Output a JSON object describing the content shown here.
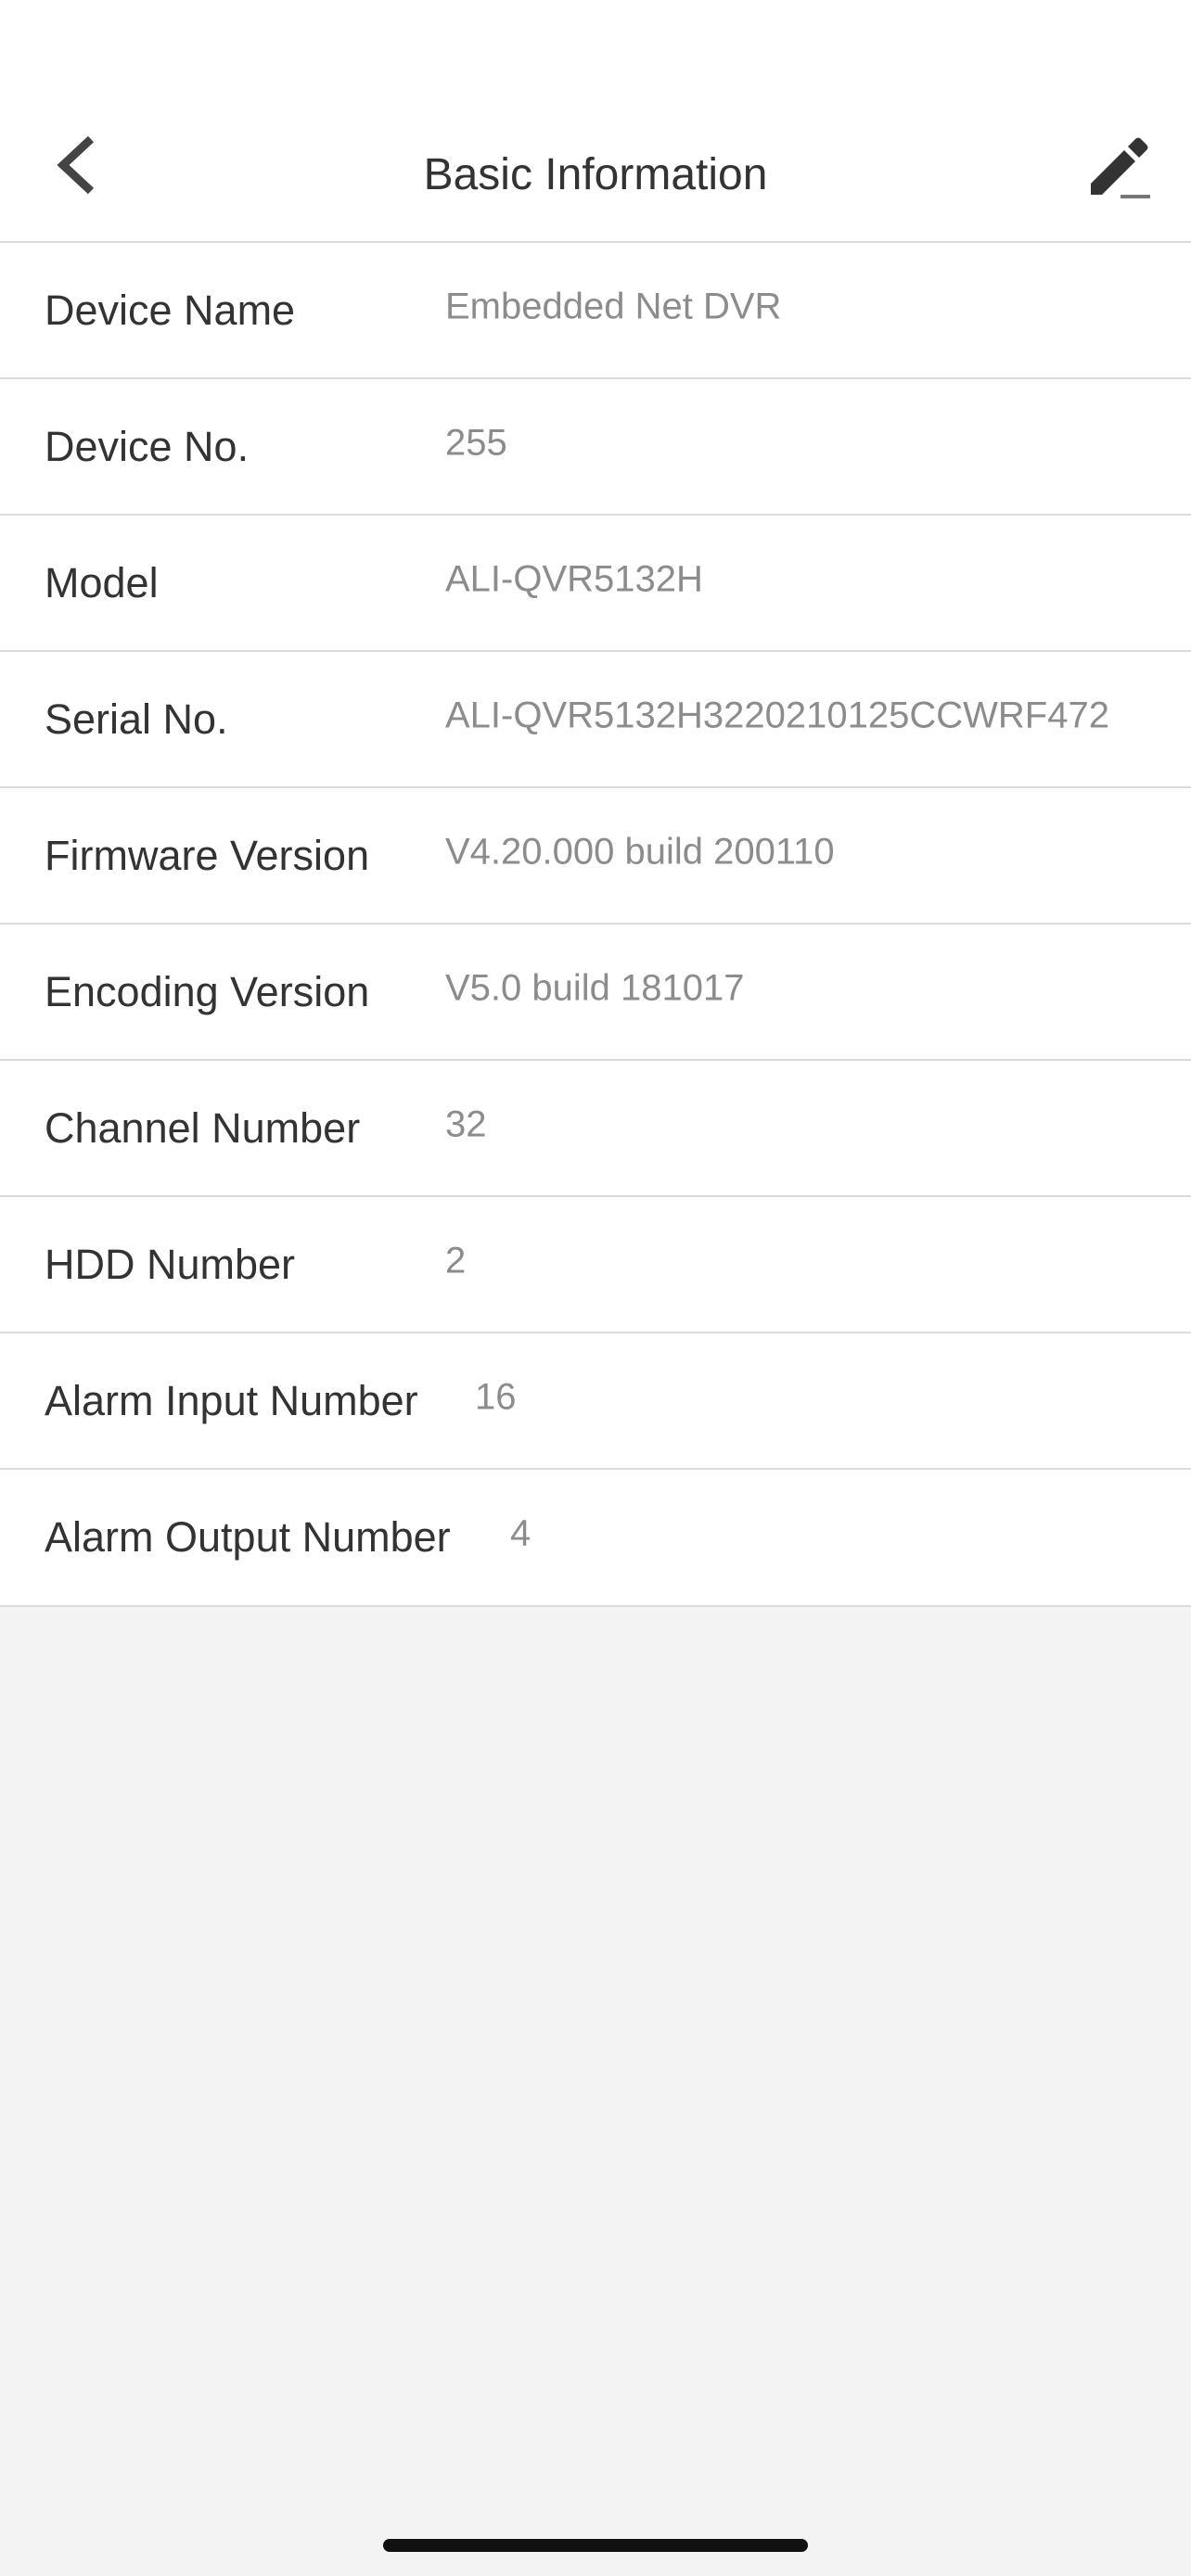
{
  "header": {
    "title": "Basic Information",
    "back_icon": "chevron-left-icon",
    "edit_icon": "pencil-icon"
  },
  "info": [
    {
      "label": "Device Name",
      "value": "Embedded Net DVR"
    },
    {
      "label": "Device No.",
      "value": "255"
    },
    {
      "label": "Model",
      "value": "ALI-QVR5132H"
    },
    {
      "label": "Serial No.",
      "value": "ALI-QVR5132H3220210125CCWRF472"
    },
    {
      "label": "Firmware Version",
      "value": "V4.20.000 build 200110"
    },
    {
      "label": "Encoding Version",
      "value": "V5.0 build 181017"
    },
    {
      "label": "Channel Number",
      "value": "32"
    },
    {
      "label": "HDD Number",
      "value": "2"
    },
    {
      "label": "Alarm Input Number",
      "value": "16"
    },
    {
      "label": "Alarm Output Number",
      "value": "4"
    }
  ],
  "colors": {
    "background": "#f3f3f3",
    "surface": "#ffffff",
    "label_text": "#333333",
    "value_text": "#8c8c8c",
    "divider": "#dcdcdc"
  }
}
